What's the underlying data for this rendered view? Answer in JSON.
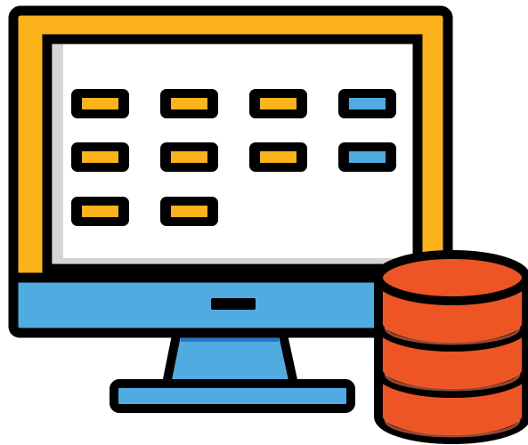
{
  "colors": {
    "outline": "#000000",
    "frame": "#fbb21b",
    "screen": "#ffffff",
    "screen_shadow": "#d5d5d5",
    "bezel": "#4fabe0",
    "stand_shadow": "#2576c8",
    "tile_yellow": "#fbb21b",
    "tile_blue": "#4fabe0",
    "database": "#ee5524",
    "database_highlight": "#f2795a"
  },
  "icons": {
    "monitor": "monitor-icon",
    "database": "database-icon"
  },
  "screen": {
    "grid": {
      "rows": [
        [
          "yellow",
          "yellow",
          "yellow",
          "blue"
        ],
        [
          "yellow",
          "yellow",
          "yellow",
          "blue"
        ],
        [
          "yellow",
          "yellow"
        ]
      ]
    }
  },
  "database": {
    "disk_count": 3
  }
}
